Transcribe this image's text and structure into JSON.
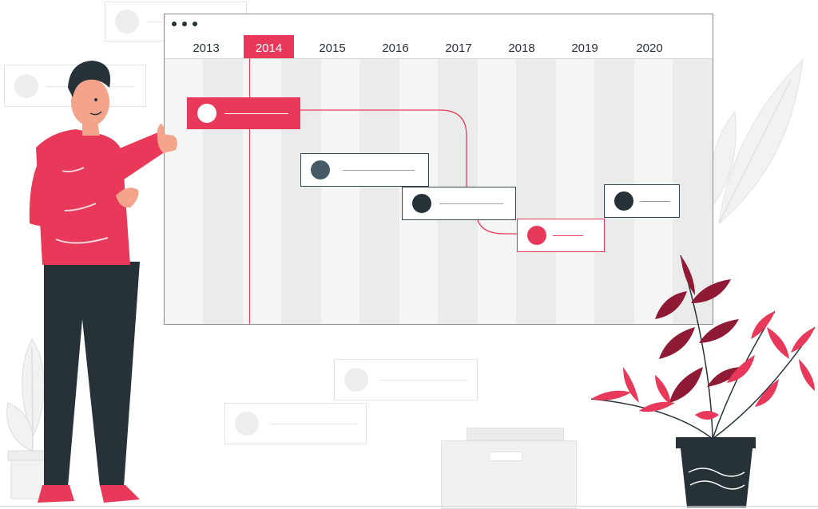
{
  "timeline": {
    "years": [
      "2013",
      "2014",
      "2015",
      "2016",
      "2017",
      "2018",
      "2019",
      "2020"
    ],
    "active_year": "2014",
    "window_dots": 3
  },
  "colors": {
    "accent": "#e8395a",
    "dark": "#263238",
    "deep_red": "#8e1a35",
    "light_gray": "#ebebeb"
  },
  "icons": [
    "user-avatar-icon",
    "window-dots-icon"
  ]
}
